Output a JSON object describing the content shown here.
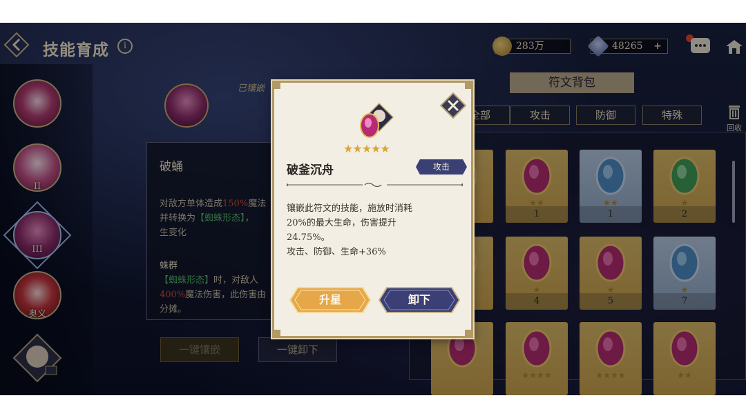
{
  "header": {
    "title": "技能育成",
    "gold": "283万",
    "gems": "48265",
    "gem_plus": "+"
  },
  "left_skills": [
    {
      "label": ""
    },
    {
      "label": "II"
    },
    {
      "label": "III"
    },
    {
      "label": "奥义"
    }
  ],
  "skill_detail": {
    "embedded_label": "已镶嵌",
    "name": "破蛹",
    "desc_line1_a": "对敌方单体造成",
    "desc_line1_b": "150%",
    "desc_line1_c": "魔法",
    "desc_line2_a": "并转换为",
    "desc_line2_b": "【蜘蛛形态】",
    "desc_line2_c": "，",
    "desc_line3": "生变化",
    "sub_title": "蛛群",
    "sub_line1_a": "【蜘蛛形态】",
    "sub_line1_b": "时，对敌人",
    "sub_line2_a": "400%",
    "sub_line2_b": "魔法伤害，此伤害由",
    "sub_line3": "分摊。",
    "btn_embed_all": "一键镶嵌",
    "btn_remove_all": "一键卸下"
  },
  "rune_bag": {
    "title": "符文背包",
    "filters": [
      "全部",
      "攻击",
      "防御",
      "特殊"
    ],
    "recycle_label": "回收",
    "cards": [
      {
        "count": "",
        "style": "gold",
        "stars": ""
      },
      {
        "count": "1",
        "style": "gold",
        "stars": "★★"
      },
      {
        "count": "1",
        "style": "blue",
        "stars": "★★"
      },
      {
        "count": "2",
        "style": "gold",
        "stars": "★"
      },
      {
        "count": "",
        "style": "gold",
        "stars": ""
      },
      {
        "count": "4",
        "style": "gold",
        "stars": "★"
      },
      {
        "count": "5",
        "style": "gold",
        "stars": "★"
      },
      {
        "count": "7",
        "style": "blue",
        "stars": "★"
      },
      {
        "count": "",
        "style": "gold",
        "stars": ""
      },
      {
        "count": "",
        "style": "gold",
        "stars": "★★★★"
      },
      {
        "count": "",
        "style": "gold",
        "stars": "★★★★"
      },
      {
        "count": "",
        "style": "gold",
        "stars": "★★"
      }
    ]
  },
  "modal": {
    "stars": "★★★★★",
    "rune_name": "破釜沉舟",
    "type_badge": "攻击",
    "desc_line1": "镶嵌此符文的技能，施放时消耗",
    "desc_line2": "20%的最大生命，伤害提升",
    "desc_line3": "24.75%。",
    "desc_line4": "攻击、防御、生命+36%",
    "btn_upgrade": "升星",
    "btn_remove": "卸下"
  },
  "icons": {
    "back": "back-arrow-icon",
    "info": "info-icon",
    "gold": "coin-icon",
    "gem": "gem-icon",
    "chat": "chat-icon",
    "home": "home-icon",
    "close": "close-icon",
    "recycle": "trash-icon"
  },
  "colors": {
    "accent_gold": "#b39a64",
    "badge_navy": "#3a3f74",
    "upgrade_orange": "#e3a94a",
    "remove_navy": "#3b3f75",
    "highlight_red": "#d24936",
    "highlight_green": "#53b866"
  }
}
